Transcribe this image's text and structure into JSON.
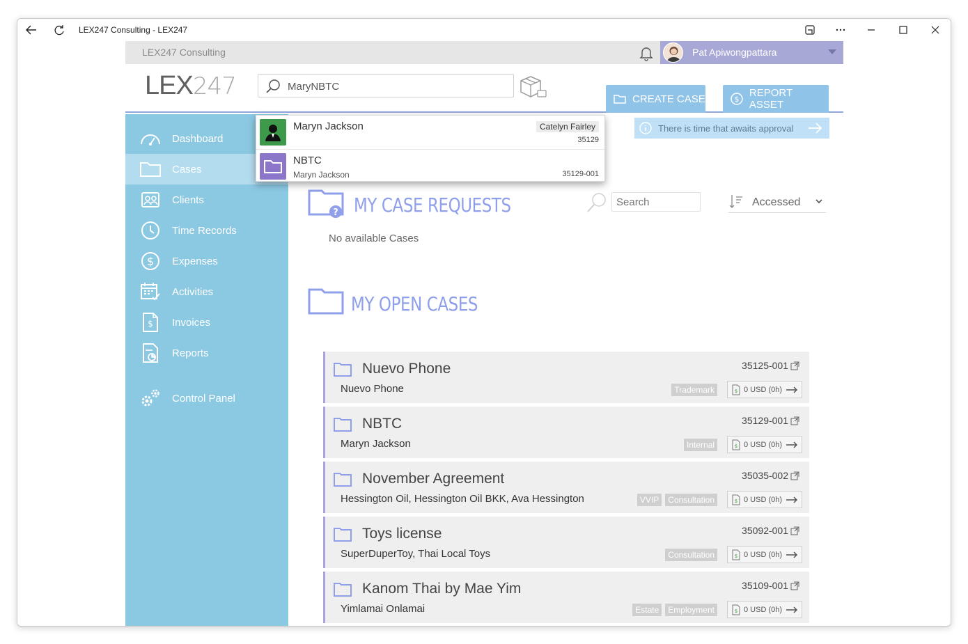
{
  "window": {
    "title": "LEX247 Consulting - LEX247"
  },
  "topbar": {
    "org_name": "LEX247 Consulting",
    "user_name": "Pat Apiwongpattara"
  },
  "header": {
    "logo_bold": "LEX",
    "logo_thin": "247",
    "search_value": "MaryNBTC",
    "create_case_label": "CREATE CASE",
    "report_asset_label": "REPORT ASSET",
    "notice_text": "There is time that awaits approval"
  },
  "search_results": [
    {
      "title": "Maryn Jackson",
      "tag": "Catelyn Fairley",
      "number": "35129",
      "icon": "person-icon",
      "color": "#3d9a4a"
    },
    {
      "title": "NBTC",
      "subtitle": "Maryn Jackson",
      "number": "35129-001",
      "icon": "folder-icon",
      "color": "#8c76c9"
    }
  ],
  "sidebar": {
    "items": [
      {
        "label": "Dashboard",
        "icon": "dashboard-icon"
      },
      {
        "label": "Cases",
        "icon": "folder-icon",
        "active": true
      },
      {
        "label": "Clients",
        "icon": "clients-icon"
      },
      {
        "label": "Time Records",
        "icon": "clock-icon"
      },
      {
        "label": "Expenses",
        "icon": "dollar-icon"
      },
      {
        "label": "Activities",
        "icon": "calendar-icon"
      },
      {
        "label": "Invoices",
        "icon": "invoice-icon"
      },
      {
        "label": "Reports",
        "icon": "report-icon"
      },
      {
        "label": "Control Panel",
        "icon": "gears-icon"
      }
    ]
  },
  "requests": {
    "heading": "MY CASE REQUESTS",
    "empty_text": "No available Cases",
    "search_placeholder": "Search",
    "sort_label": "Accessed"
  },
  "open_cases": {
    "heading": "MY OPEN CASES",
    "cases": [
      {
        "title": "Nuevo Phone",
        "subtitle": "Nuevo Phone",
        "number": "35125-001",
        "tags": [
          "Trademark"
        ],
        "billing": "0 USD (0h)"
      },
      {
        "title": "NBTC",
        "subtitle": "Maryn Jackson",
        "number": "35129-001",
        "tags": [
          "Internal"
        ],
        "billing": "0 USD (0h)"
      },
      {
        "title": "November Agreement",
        "subtitle": "Hessington Oil, Hessington Oil BKK, Ava Hessington",
        "number": "35035-002",
        "tags": [
          "VVIP",
          "Consultation"
        ],
        "billing": "0 USD (0h)"
      },
      {
        "title": "Toys license",
        "subtitle": "SuperDuperToy, Thai Local Toys",
        "number": "35092-001",
        "tags": [
          "Consultation"
        ],
        "billing": "0 USD (0h)"
      },
      {
        "title": "Kanom Thai by Mae Yim",
        "subtitle": "Yimlamai Onlamai",
        "number": "35109-001",
        "tags": [
          "Estate",
          "Employment"
        ],
        "billing": "0 USD (0h)"
      }
    ]
  },
  "colors": {
    "sidebar": "#8bc8e2",
    "accent": "#8f9fe9",
    "header_button": "#8fc3e8",
    "user_bar": "#a8a8d6"
  }
}
